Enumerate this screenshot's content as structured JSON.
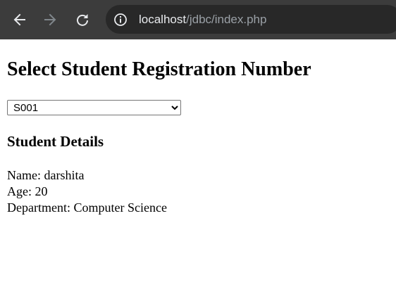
{
  "browser": {
    "url_host": "localhost",
    "url_path": "/jdbc/index.php",
    "icons": {
      "back": "arrow-left-icon",
      "forward": "arrow-right-icon",
      "reload": "reload-icon",
      "site_info": "info-circle-icon"
    }
  },
  "page": {
    "title": "Select Student Registration Number",
    "select": {
      "selected": "S001",
      "options": [
        "S001"
      ]
    },
    "details_heading": "Student Details",
    "details": {
      "name_label": "Name:",
      "name_value": "darshita",
      "age_label": "Age:",
      "age_value": "20",
      "department_label": "Department:",
      "department_value": "Computer Science"
    }
  }
}
